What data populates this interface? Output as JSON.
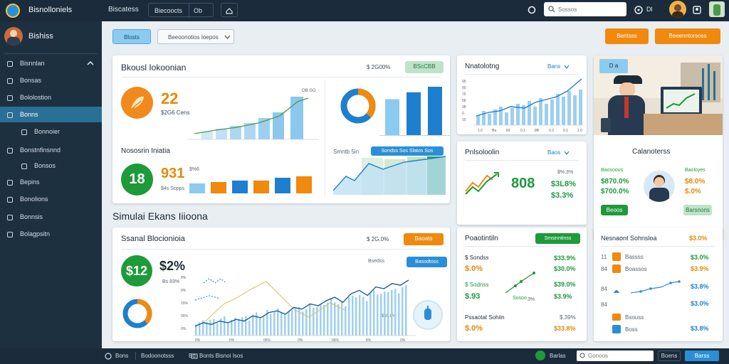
{
  "topbar": {
    "app_name": "Bisnolloniels",
    "nav_label": "Biscatess",
    "tab_label": "Biecoocts",
    "tab_extra": "Ob",
    "search_placeholder": "Sossos",
    "user_badge": "Dl"
  },
  "sidebar": {
    "brand": "Bishiss",
    "items": [
      {
        "label": "Bisnnlan",
        "icon": "folder-icon"
      },
      {
        "label": "Bonsas",
        "icon": "document-icon"
      },
      {
        "label": "Bololostion",
        "icon": "clipboard-icon"
      },
      {
        "label": "Bonns",
        "icon": "book-icon"
      },
      {
        "label": "Bonnoier",
        "icon": "list-icon"
      },
      {
        "label": "Bonstnfinsnnd",
        "icon": "box-icon"
      },
      {
        "label": "Bonsos",
        "icon": "gear-icon"
      },
      {
        "label": "Bepins",
        "icon": "globe-icon"
      },
      {
        "label": "Bonolions",
        "icon": "clock-icon"
      },
      {
        "label": "Bonnsis",
        "icon": "settings-icon"
      },
      {
        "label": "Bolagpsitn",
        "icon": "tools-icon"
      }
    ]
  },
  "toolbar": {
    "left_button": "Blosts",
    "dropdown_label": "Beeoonotios Ioepos",
    "right_button_1": "Bentsss",
    "right_button_2": "Beeenntorsoss"
  },
  "card_main": {
    "title": "Bkousl Iokoonian",
    "stat_label": "$ 2G00%",
    "badge": "BScCBB",
    "kpi1_value": "22",
    "kpi1_sub": "$2G6 Cens",
    "chart_tag": "OB GG",
    "section2_title": "Nososrin Iniatia",
    "kpi2_value": "18",
    "kpi2_big": "931",
    "kpi2_small": "$%6",
    "kpi2_sub": "$4s Sopps",
    "mini_tabs_label": "Smntb 5in",
    "mini_tabs": "Sondss  Sos Slatos  Sos",
    "bars": [
      28,
      30,
      34,
      40,
      52,
      62,
      70
    ]
  },
  "card_topright": {
    "title": "Nnatolotng",
    "tag": "Bans",
    "y_ticks": [
      "95",
      "90",
      "75",
      "58",
      "38",
      "0",
      "15"
    ],
    "x_ticks": [
      "1.0",
      "Ba",
      "83",
      "0.1",
      "8B",
      "0.3",
      "0.1",
      "2.0"
    ]
  },
  "card_midright": {
    "title": "Pnlsoloolin",
    "tag": "Baos",
    "value": "808",
    "stat1": "$3L8%",
    "stat2": "$3.3%",
    "stat_label": "$%,3%"
  },
  "card_photo": {
    "badge": "D a",
    "title": "Calanoterss",
    "left_label": "Baosoous",
    "left_value1": "$870.0%",
    "left_value2": "$700.0%",
    "right_label": "Baoloyes",
    "right_value1": "$8.0%",
    "right_value2": "$.0%",
    "left_button": "Beoos",
    "right_button": "Barsnons"
  },
  "section_heading": "Simulai Ekans Iiioona",
  "card_bottom_main": {
    "title": "Ssanal Blocionioia",
    "stat_label": "$ 2G.0%",
    "badge": "Baoats",
    "kpi_value": "$12",
    "kpi_pct": "$2%",
    "kpi_sub": "Bs 83%",
    "legend_label": "Bsedss",
    "legend_tag": "Basodtoss",
    "y_ticks": [
      "8%",
      "9%",
      "15%",
      "05%",
      "0%"
    ],
    "x_ticks": [
      "0%",
      "0%",
      "06%",
      "0%",
      "06%",
      "8%",
      "0%"
    ],
    "chart_note": "$35.8%",
    "series": [
      3,
      5,
      4,
      6,
      5,
      7,
      6,
      9,
      8,
      11,
      12,
      10,
      14,
      13,
      16,
      15,
      18,
      20,
      17,
      22,
      24,
      21,
      26,
      25,
      28,
      27,
      30
    ]
  },
  "card_bottom_mid": {
    "title": "Poaotintiln",
    "tag": "Smsinntinss",
    "rows": [
      {
        "l1": "$ Sondss",
        "l2": "$.0%",
        "r1": "$33.9%",
        "r2": "$30.0%"
      },
      {
        "l1": "$ Sodnss",
        "l2": "$.93",
        "r1": "$39.0%",
        "r2": "$3.9%"
      },
      {
        "l1": "Pssaotat Sohiin",
        "l2": "$.0%",
        "r1": "$.39%",
        "r2": "$33.8%"
      }
    ],
    "mid_label": "Sosoo",
    "small_label": "3%"
  },
  "card_bottom_right": {
    "title": "Nesnaont Sohnsloa",
    "tag": "$3.0%",
    "rows": [
      {
        "n": "11",
        "label": "Bassss",
        "value": "$3.0%"
      },
      {
        "n": "84",
        "label": "Boassos",
        "value": "$3.9%"
      },
      {
        "n": "84",
        "label": "",
        "value": "$3.8%"
      },
      {
        "n": "84",
        "label": "Bsouss",
        "value": "$3.0%"
      },
      {
        "n": "",
        "label": "Boss",
        "value": "$3.8%"
      }
    ]
  },
  "footer": {
    "item1": "Bons",
    "item2": "Bodoonotsss",
    "item3": "Bo",
    "item4": "Bonts Bisnoi Isos",
    "right_label": "Barlas",
    "search_placeholder": "Gonoos",
    "btn1": "Boens",
    "btn2": "Barss"
  },
  "colors": {
    "accent_blue": "#2a8fd6",
    "accent_green": "#1e9a3a",
    "accent_orange": "#f0890d",
    "nav_bg": "#1b2b3b"
  }
}
